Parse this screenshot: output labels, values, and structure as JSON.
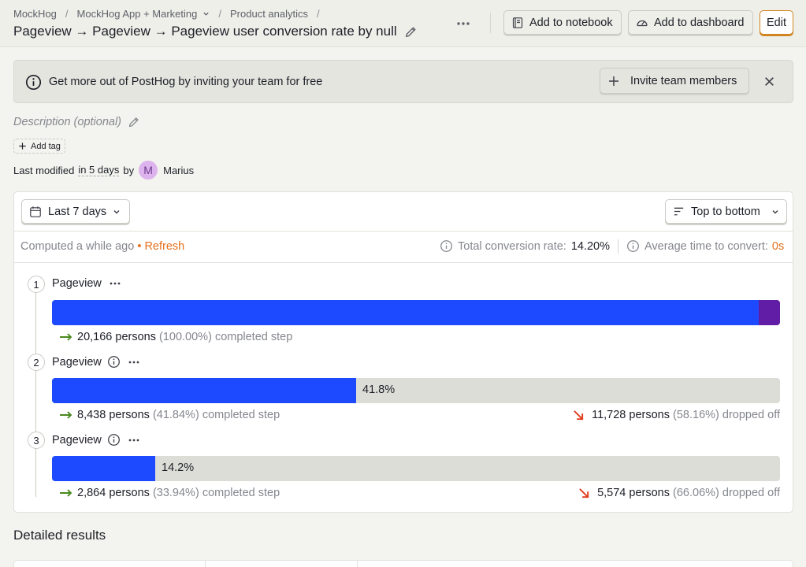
{
  "breadcrumb": {
    "items": [
      "MockHog",
      "MockHog App + Marketing",
      "Product analytics"
    ],
    "separator": "/"
  },
  "title": "Pageview → Pageview → Pageview user conversion rate by null",
  "header_actions": {
    "add_to_notebook": "Add to notebook",
    "add_to_dashboard": "Add to dashboard",
    "edit": "Edit"
  },
  "banner": {
    "text": "Get more out of PostHog by inviting your team for free",
    "invite_button": "Invite team members"
  },
  "meta": {
    "description_placeholder": "Description (optional)",
    "add_tag": "Add tag",
    "last_modified_prefix": "Last modified",
    "last_modified_when": "in 5 days",
    "by": "by",
    "author_initial": "M",
    "author": "Marius"
  },
  "controls": {
    "date_range": "Last 7 days",
    "order": "Top to bottom"
  },
  "stats": {
    "computed": "Computed a while ago",
    "bullet": "•",
    "refresh": "Refresh",
    "total_conversion_label": "Total conversion rate:",
    "total_conversion_value": "14.20%",
    "avg_time_label": "Average time to convert:",
    "avg_time_value": "0s"
  },
  "steps": [
    {
      "number": "1",
      "name": "Pageview",
      "conversion_fraction": 1.0,
      "bar_label": "",
      "completed_count": "20,166 persons",
      "completed_pct": "(100.00%)",
      "completed_suffix": "completed step",
      "dropped_count": "",
      "dropped_pct": "",
      "dropped_suffix": ""
    },
    {
      "number": "2",
      "name": "Pageview",
      "conversion_fraction": 0.418,
      "bar_label": "41.8%",
      "completed_count": "8,438 persons",
      "completed_pct": "(41.84%)",
      "completed_suffix": "completed step",
      "dropped_count": "11,728 persons",
      "dropped_pct": "(58.16%)",
      "dropped_suffix": "dropped off"
    },
    {
      "number": "3",
      "name": "Pageview",
      "conversion_fraction": 0.142,
      "bar_label": "14.2%",
      "completed_count": "2,864 persons",
      "completed_pct": "(33.94%)",
      "completed_suffix": "completed step",
      "dropped_count": "5,574 persons",
      "dropped_pct": "(66.06%)",
      "dropped_suffix": "dropped off"
    }
  ],
  "detailed_results": {
    "title": "Detailed results"
  },
  "colors": {
    "bar": "#1d4aff",
    "bar_end": "#621da6",
    "track": "#dcddd7",
    "accent": "#e5701d",
    "completed_arrow": "#4a8a1f",
    "dropped_arrow": "#e03a1c"
  },
  "icons": {
    "chevron": "chevron-down-icon",
    "edit": "pencil-icon",
    "more": "ellipsis-icon",
    "notebook": "notebook-icon",
    "dashboard": "gauge-icon",
    "info": "info-icon",
    "plus": "plus-icon",
    "close": "close-icon",
    "calendar": "calendar-icon",
    "sort": "sort-icon",
    "completed": "arrow-right-icon",
    "dropped": "arrow-down-right-icon"
  }
}
